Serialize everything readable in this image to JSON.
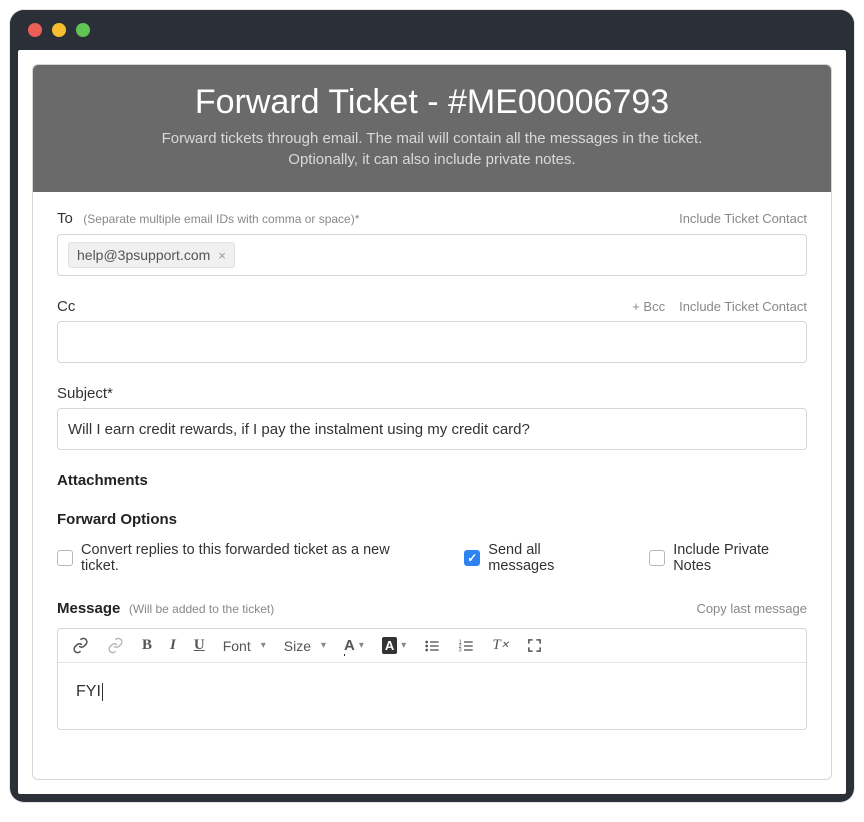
{
  "header": {
    "title": "Forward Ticket - #ME00006793",
    "subtitle_line1": "Forward tickets through email. The mail will contain all the messages in the ticket.",
    "subtitle_line2": "Optionally, it can also include private notes."
  },
  "to": {
    "label": "To",
    "hint": "(Separate multiple email IDs with comma or space)*",
    "include_contact_link": "Include Ticket Contact",
    "chip": "help@3psupport.com"
  },
  "cc": {
    "label": "Cc",
    "bcc_link": "+ Bcc",
    "include_contact_link": "Include Ticket Contact"
  },
  "subject": {
    "label": "Subject*",
    "value": "Will I earn credit rewards, if I pay the instalment using my credit card?"
  },
  "attachments": {
    "label": "Attachments"
  },
  "forward_options": {
    "label": "Forward Options",
    "opt_convert": {
      "label": "Convert replies to this forwarded ticket as a new ticket.",
      "checked": false
    },
    "opt_send_all": {
      "label": "Send all messages",
      "checked": true
    },
    "opt_private": {
      "label": "Include Private Notes",
      "checked": false
    }
  },
  "message": {
    "label": "Message",
    "hint": "(Will be added to the ticket)",
    "copy_link": "Copy last message",
    "body": "FYI"
  },
  "toolbar": {
    "font_label": "Font",
    "size_label": "Size"
  }
}
